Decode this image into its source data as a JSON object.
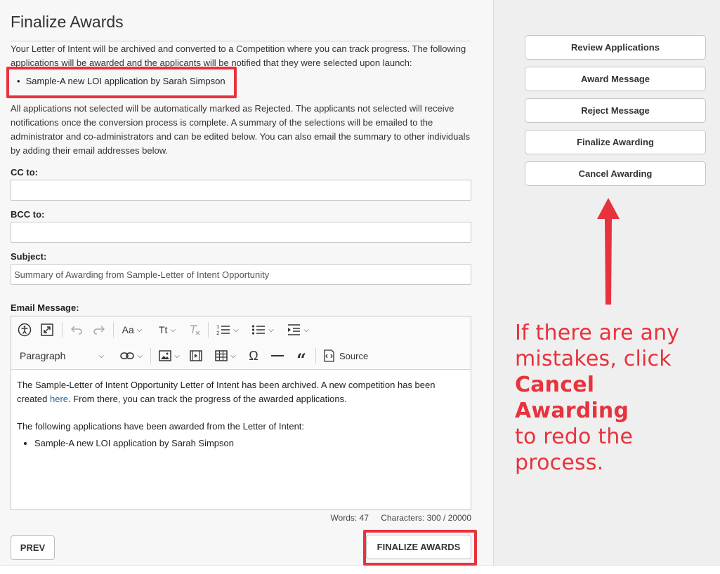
{
  "page": {
    "title": "Finalize Awards",
    "intro_text": "Your Letter of Intent will be archived and converted to a Competition where you can track progress. The following applications will be awarded and the applicants will be notified that they were selected upon launch:",
    "selected_applications": [
      "Sample-A new LOI application by Sarah Simpson"
    ],
    "info_text": "All applications not selected will be automatically marked as Rejected. The applicants not selected will receive notifications once the conversion process is complete. A summary of the selections will be emailed to the administrator and co-administrators and can be edited below. You can also email the summary to other individuals by adding their email addresses below."
  },
  "form": {
    "cc_label": "CC to:",
    "cc_value": "",
    "bcc_label": "BCC to:",
    "bcc_value": "",
    "subject_label": "Subject:",
    "subject_value": "Summary of Awarding from Sample-Letter of Intent Opportunity",
    "message_label": "Email Message:"
  },
  "editor": {
    "toolbar": {
      "font_size_label": "Aa",
      "text_transform_label": "Tt",
      "paragraph_label": "Paragraph",
      "source_label": "Source",
      "icons": [
        "accessibility-icon",
        "fullscreen-icon",
        "undo-icon",
        "redo-icon",
        "font-size-icon",
        "text-case-icon",
        "clear-formatting-icon",
        "numbered-list-icon",
        "bulleted-list-icon",
        "indent-icon",
        "link-icon",
        "image-icon",
        "media-icon",
        "table-icon",
        "special-characters-icon",
        "horizontal-line-icon",
        "blockquote-icon",
        "source-icon"
      ]
    },
    "body": {
      "line1_before_link": "The Sample-Letter of Intent Opportunity Letter of Intent has been archived. A new competition has been created ",
      "link_text": "here",
      "line1_after_link": ". From there, you can track the progress of the awarded applications.",
      "line2": "The following applications have been awarded from the Letter of Intent:",
      "awarded_list": [
        "Sample-A new LOI application by Sarah Simpson"
      ]
    },
    "words_label": "Words: 47",
    "characters_label": "Characters: 300 / 20000"
  },
  "footer": {
    "prev_label": "PREV",
    "finalize_label": "FINALIZE AWARDS"
  },
  "sidebar": {
    "buttons": [
      {
        "label": "Review Applications"
      },
      {
        "label": "Award Message"
      },
      {
        "label": "Reject Message"
      },
      {
        "label": "Finalize Awarding"
      },
      {
        "label": "Cancel Awarding"
      }
    ]
  },
  "annotation": {
    "line1": "If there are any",
    "line2": "mistakes, click",
    "emphasis": "Cancel Awarding",
    "line4": "to redo the",
    "line5": "process."
  },
  "colors": {
    "highlight": "#e8323c",
    "link": "#1a6aa8",
    "sidebar_bg": "#efefef",
    "main_bg": "#f7f7f7"
  }
}
